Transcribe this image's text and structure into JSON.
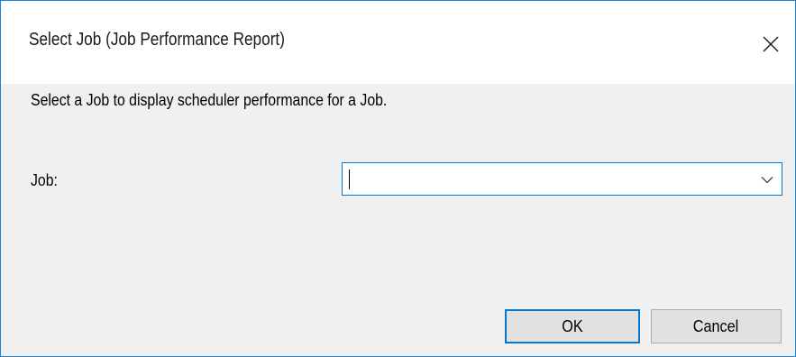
{
  "window": {
    "title": "Select Job (Job Performance Report)",
    "close_icon": "close-icon",
    "accent_color": "#0078d7"
  },
  "main": {
    "description": "Select a Job to display scheduler performance for a Job.",
    "job_field": {
      "label": "Job:",
      "value": "",
      "dropdown_icon": "chevron-down-icon"
    }
  },
  "buttons": {
    "ok_label": "OK",
    "cancel_label": "Cancel"
  }
}
